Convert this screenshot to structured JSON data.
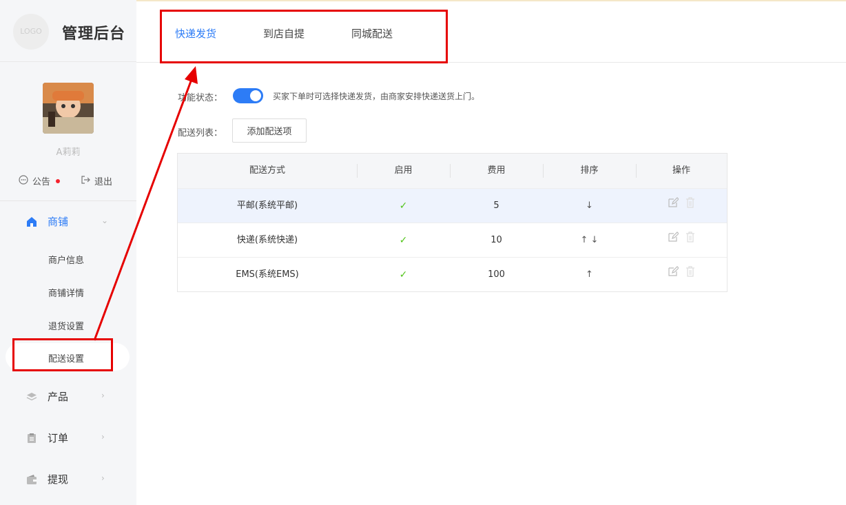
{
  "brand": {
    "logo_text": "LOGO",
    "title": "管理后台"
  },
  "user": {
    "name": "A莉莉"
  },
  "quick": {
    "notice": "公告",
    "logout": "退出"
  },
  "menu": {
    "shop": "商铺",
    "shop_subs": [
      "商户信息",
      "商铺详情",
      "退货设置",
      "配送设置"
    ],
    "product": "产品",
    "order": "订单",
    "withdraw": "提现"
  },
  "tabs": [
    "快递发货",
    "到店自提",
    "同城配送"
  ],
  "form": {
    "status_label": "功能状态：",
    "status_desc": "买家下单时可选择快递发货，由商家安排快递送货上门。",
    "list_label": "配送列表：",
    "add_button": "添加配送项"
  },
  "table": {
    "headers": [
      "配送方式",
      "启用",
      "费用",
      "排序",
      "操作"
    ],
    "rows": [
      {
        "name": "平邮(系统平邮)",
        "enabled": "✓",
        "fee": "5",
        "sort": "↓"
      },
      {
        "name": "快递(系统快递)",
        "enabled": "✓",
        "fee": "10",
        "sort": "↑ ↓"
      },
      {
        "name": "EMS(系统EMS)",
        "enabled": "✓",
        "fee": "100",
        "sort": "↑"
      }
    ]
  },
  "colors": {
    "accent": "#2d7cf6",
    "annotation": "#e60000",
    "check": "#52c41a"
  }
}
